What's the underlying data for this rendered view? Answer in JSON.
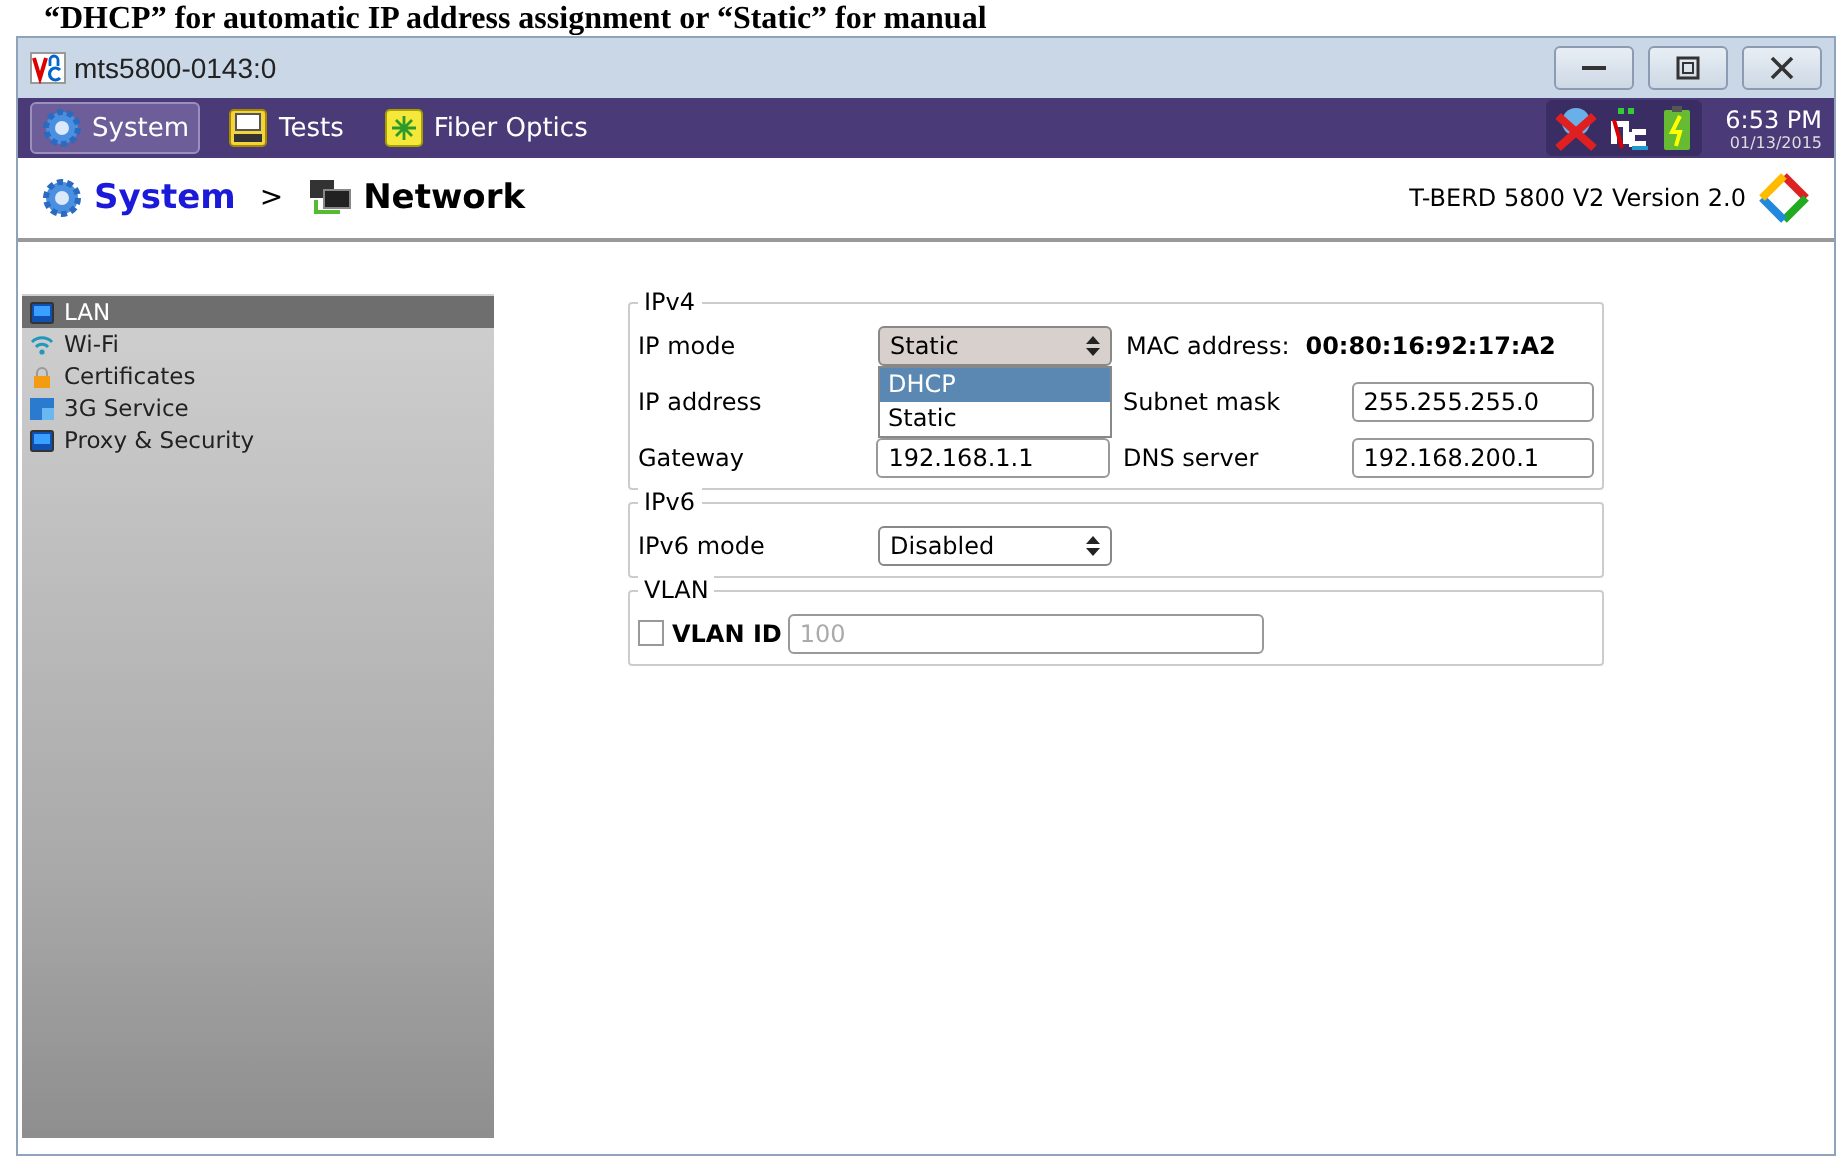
{
  "caption": "“DHCP” for automatic IP address assignment or “Static” for manual",
  "window": {
    "title": "mts5800-0143:0"
  },
  "toolbar": {
    "items": [
      {
        "label": "System",
        "selected": true,
        "kind": "gear"
      },
      {
        "label": "Tests",
        "selected": false,
        "kind": "bert"
      },
      {
        "label": "Fiber Optics",
        "selected": false,
        "kind": "fiber"
      }
    ],
    "time": "6:53 PM",
    "date": "01/13/2015"
  },
  "header": {
    "breadcrumb": [
      "System",
      "Network"
    ],
    "separator": ">",
    "version": "T-BERD 5800 V2 Version 2.0"
  },
  "sidebar": {
    "items": [
      {
        "label": "LAN",
        "selected": true,
        "kind": "lan"
      },
      {
        "label": "Wi-Fi",
        "selected": false,
        "kind": "wifi"
      },
      {
        "label": "Certificates",
        "selected": false,
        "kind": "lock"
      },
      {
        "label": "3G Service",
        "selected": false,
        "kind": "cellular"
      },
      {
        "label": "Proxy & Security",
        "selected": false,
        "kind": "lan"
      }
    ]
  },
  "ipv4": {
    "legend": "IPv4",
    "ip_mode": {
      "label": "IP mode",
      "value": "Static",
      "expanded": true,
      "options": [
        {
          "label": "DHCP",
          "highlighted": true
        },
        {
          "label": "Static",
          "highlighted": false
        }
      ]
    },
    "mac": {
      "label": "MAC address:",
      "value": "00:80:16:92:17:A2"
    },
    "ip_address": {
      "label": "IP address"
    },
    "subnet": {
      "label": "Subnet mask",
      "value": "255.255.255.0"
    },
    "gateway": {
      "label": "Gateway",
      "value": "192.168.1.1"
    },
    "dns": {
      "label": "DNS server",
      "value": "192.168.200.1"
    }
  },
  "ipv6": {
    "legend": "IPv6",
    "mode": {
      "label": "IPv6 mode",
      "value": "Disabled"
    }
  },
  "vlan": {
    "legend": "VLAN",
    "checked": false,
    "label": "VLAN ID",
    "placeholder": "100"
  }
}
